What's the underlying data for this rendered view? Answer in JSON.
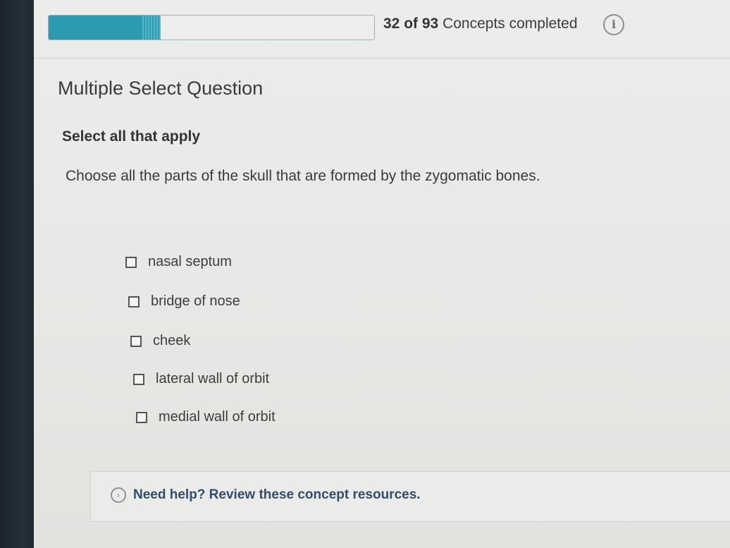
{
  "progress": {
    "count_text": "32 of 93",
    "suffix_text": "Concepts completed",
    "completed": 32,
    "total": 93,
    "fill_color": "#2a9bb1"
  },
  "info_icon": "info-icon",
  "question": {
    "type_label": "Multiple Select Question",
    "instruction": "Select all that apply",
    "prompt": "Choose all the parts of the skull that are formed by the zygomatic bones.",
    "options": [
      {
        "label": "nasal septum",
        "checked": false
      },
      {
        "label": "bridge of nose",
        "checked": false
      },
      {
        "label": "cheek",
        "checked": false
      },
      {
        "label": "lateral wall of orbit",
        "checked": false
      },
      {
        "label": "medial wall of orbit",
        "checked": false
      }
    ]
  },
  "help": {
    "label": "Need help? Review these concept resources.",
    "icon": "chevron-right-icon"
  }
}
